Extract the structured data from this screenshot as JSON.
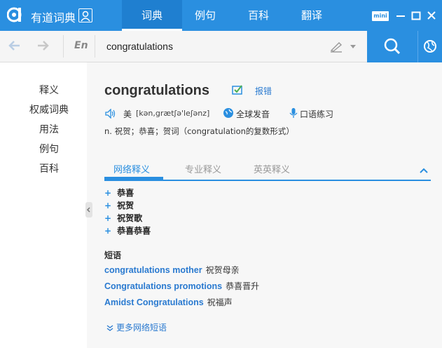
{
  "app": {
    "name": "有道词典"
  },
  "nav": {
    "tabs": [
      "词典",
      "例句",
      "百科",
      "翻译"
    ],
    "active": 0
  },
  "window": {
    "mini_label": "mini"
  },
  "search": {
    "lang": "En",
    "query": "congratulations"
  },
  "sidebar": {
    "items": [
      "释义",
      "权威词典",
      "用法",
      "例句",
      "百科"
    ]
  },
  "entry": {
    "headword": "congratulations",
    "report_label": "报错",
    "accent": "美",
    "phonetic": "[kən,grætʃə'leʃənz]",
    "global_pron_label": "全球发音",
    "oral_practice_label": "口语练习",
    "definition": "n. 祝贺；恭喜；贺词（congratulation的复数形式）"
  },
  "def_tabs": [
    "网络释义",
    "专业释义",
    "英英释义"
  ],
  "meanings": [
    "恭喜",
    "祝贺",
    "祝贺歌",
    "恭喜恭喜"
  ],
  "phrases": {
    "title": "短语",
    "items": [
      {
        "en": "congratulations mother",
        "zh": "祝贺母亲"
      },
      {
        "en": "Congratulations promotions",
        "zh": "恭喜晋升"
      },
      {
        "en": "Amidst Congratulations",
        "zh": "祝福声"
      }
    ],
    "more_label": "更多网络短语"
  },
  "colors": {
    "brand": "#2a8fe0",
    "link": "#2a7ad0"
  }
}
